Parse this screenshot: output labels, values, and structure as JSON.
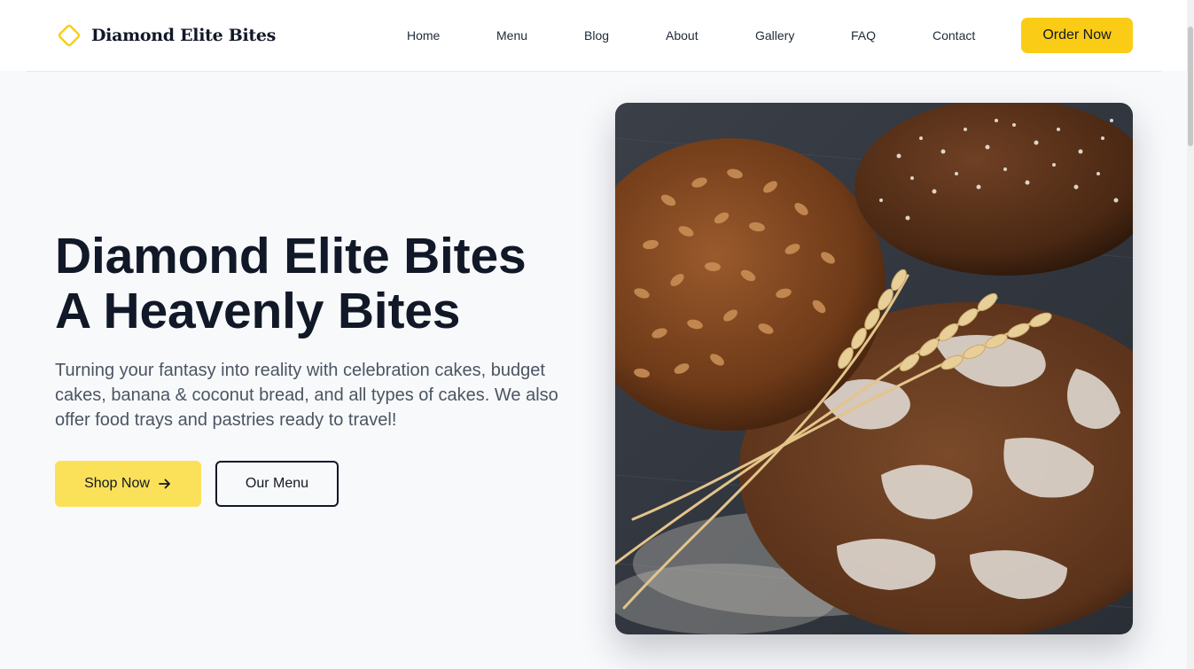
{
  "brand": {
    "name": "Diamond Elite Bites",
    "accent_color": "#facc15",
    "logo_icon": "diamond-outline-icon"
  },
  "nav": {
    "items": [
      {
        "label": "Home"
      },
      {
        "label": "Menu"
      },
      {
        "label": "Blog"
      },
      {
        "label": "About"
      },
      {
        "label": "Gallery"
      },
      {
        "label": "FAQ"
      },
      {
        "label": "Contact"
      }
    ],
    "cta_label": "Order Now"
  },
  "hero": {
    "title_line1": "Diamond Elite Bites",
    "title_line2": "A Heavenly Bites",
    "description": "Turning your fantasy into reality with celebration cakes, budget cakes, banana & coconut bread, and all types of cakes. We also offer food trays and pastries ready to travel!",
    "primary_button": {
      "label": "Shop Now",
      "icon": "arrow-right-icon",
      "color": "#fbe15a"
    },
    "secondary_button": {
      "label": "Our Menu"
    },
    "image": {
      "subject": "rustic-bread-loaves-with-wheat-photo"
    }
  },
  "colors": {
    "page_background": "#f8f9fb",
    "header_background": "#ffffff",
    "text_primary": "#111827",
    "text_secondary": "#4b5563"
  }
}
